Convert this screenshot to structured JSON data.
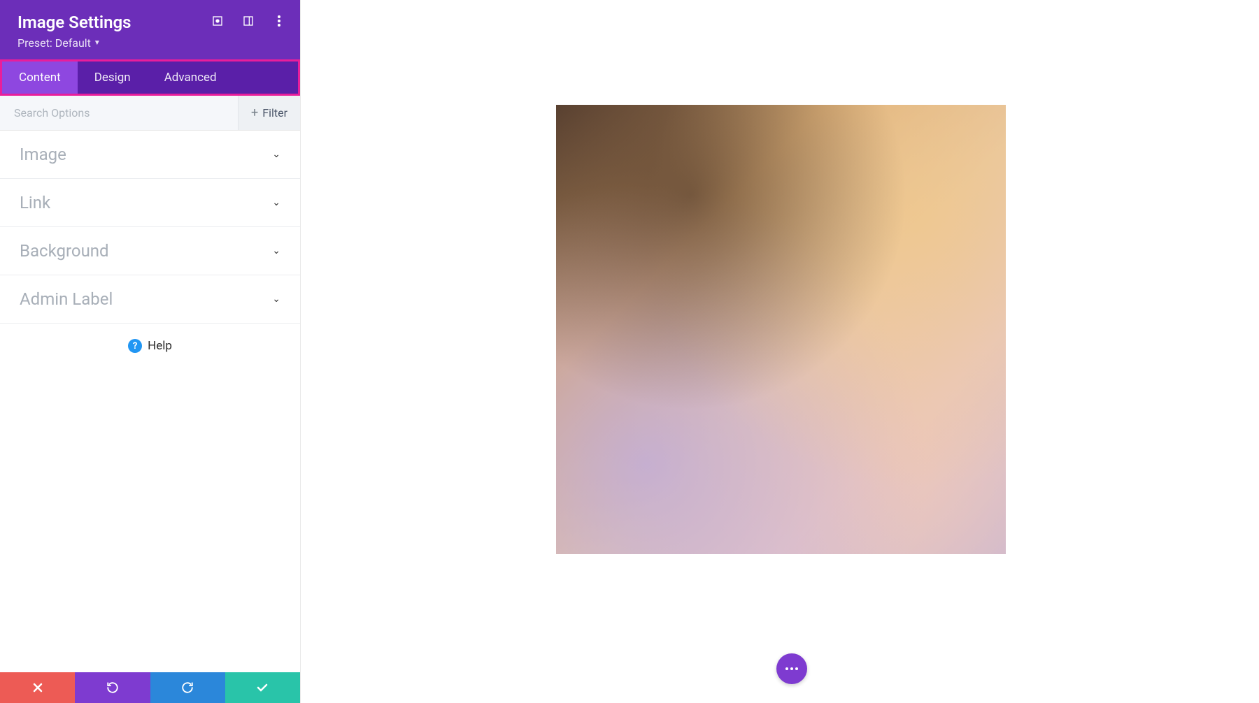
{
  "header": {
    "title": "Image Settings",
    "preset_prefix": "Preset: ",
    "preset_value": "Default"
  },
  "tabs": [
    {
      "label": "Content",
      "active": true
    },
    {
      "label": "Design",
      "active": false
    },
    {
      "label": "Advanced",
      "active": false
    }
  ],
  "search": {
    "placeholder": "Search Options",
    "filter_label": "Filter"
  },
  "sections": [
    {
      "label": "Image"
    },
    {
      "label": "Link"
    },
    {
      "label": "Background"
    },
    {
      "label": "Admin Label"
    }
  ],
  "help": {
    "label": "Help"
  }
}
